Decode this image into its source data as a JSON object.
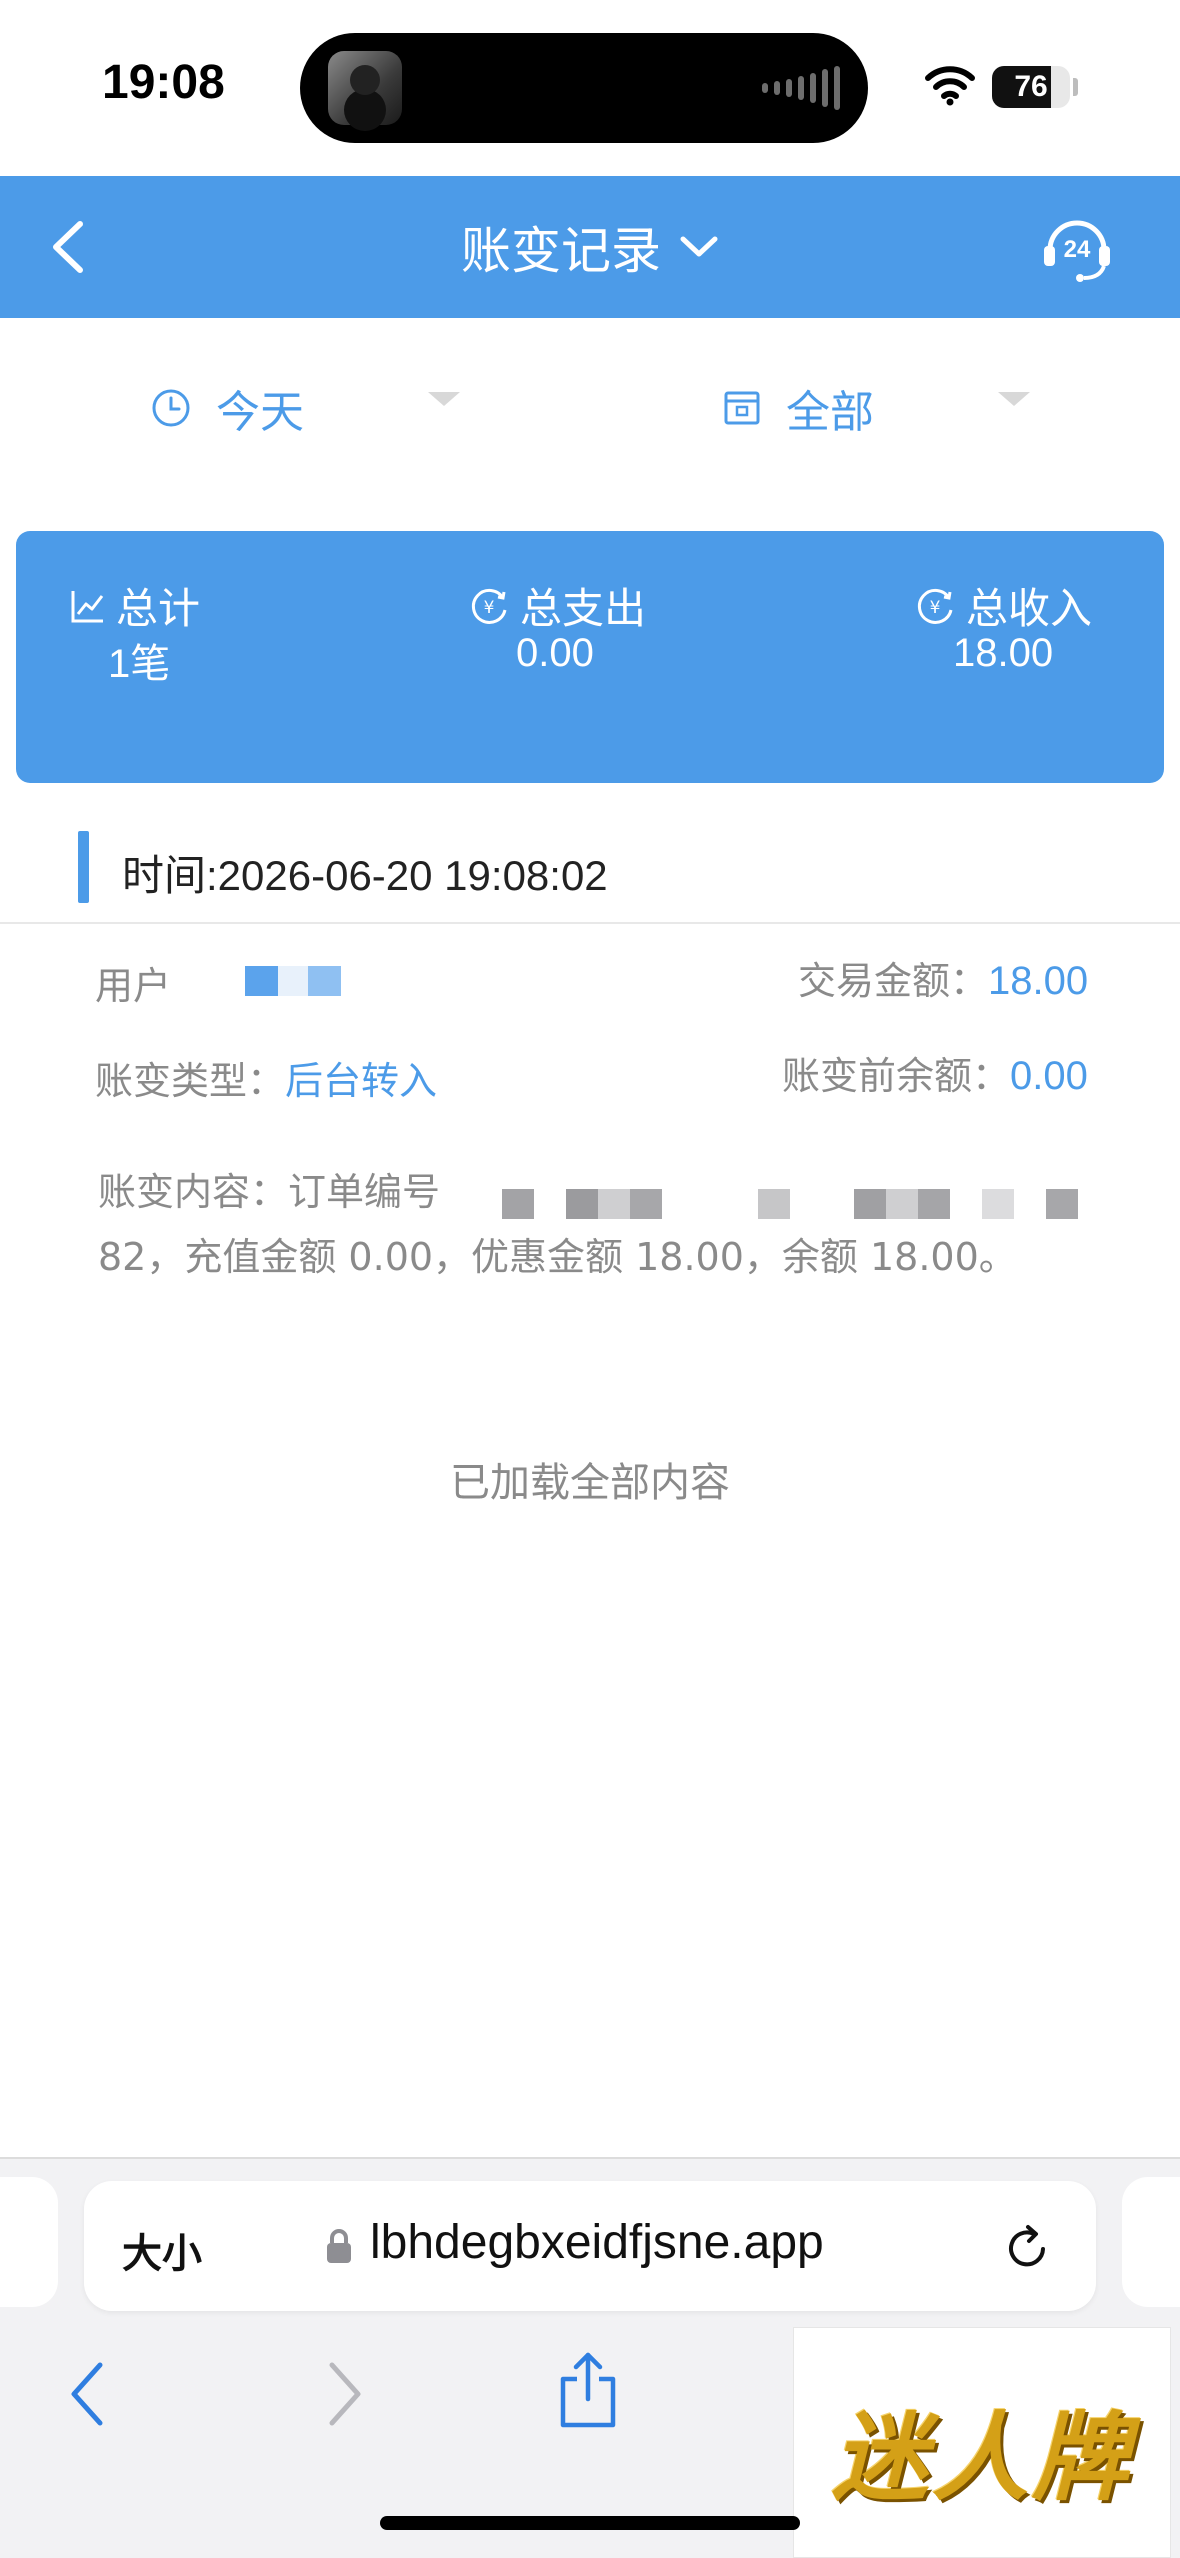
{
  "status_bar": {
    "time": "19:08",
    "battery": "76",
    "battery_level": 0.76
  },
  "header": {
    "title": "账变记录",
    "back_icon": "chevron-left-icon",
    "dropdown_icon": "chevron-down-icon",
    "support_icon": "headset-24-icon",
    "support_label": "24"
  },
  "filters": {
    "date": {
      "label": "今天",
      "icon": "clock-icon"
    },
    "type": {
      "label": "全部",
      "icon": "calendar-icon"
    }
  },
  "summary": {
    "total_label": "总计",
    "total_value": "1笔",
    "expense_label": "总支出",
    "expense_value": "0.00",
    "income_label": "总收入",
    "income_value": "18.00"
  },
  "record": {
    "time": "时间:2026-06-20 19:08:02",
    "user_label": "用户",
    "amount_label": "交易金额：",
    "amount_value": "18.00",
    "type_label": "账变类型：",
    "type_value": "后台转入",
    "balance_before_label": "账变前余额：",
    "balance_before_value": "0.00",
    "content_prefix": "账变内容：订单编号",
    "content_rest": "82，充值金额 0.00，优惠金额 18.00，余额 18.00。"
  },
  "list_end": "已加载全部内容",
  "browser": {
    "text_size_label": "大小",
    "url": "lbhdegbxeidfjsne.app"
  },
  "watermark": "迷人牌",
  "colors": {
    "accent": "#4c9be8",
    "muted_text": "#8a8a8a"
  }
}
